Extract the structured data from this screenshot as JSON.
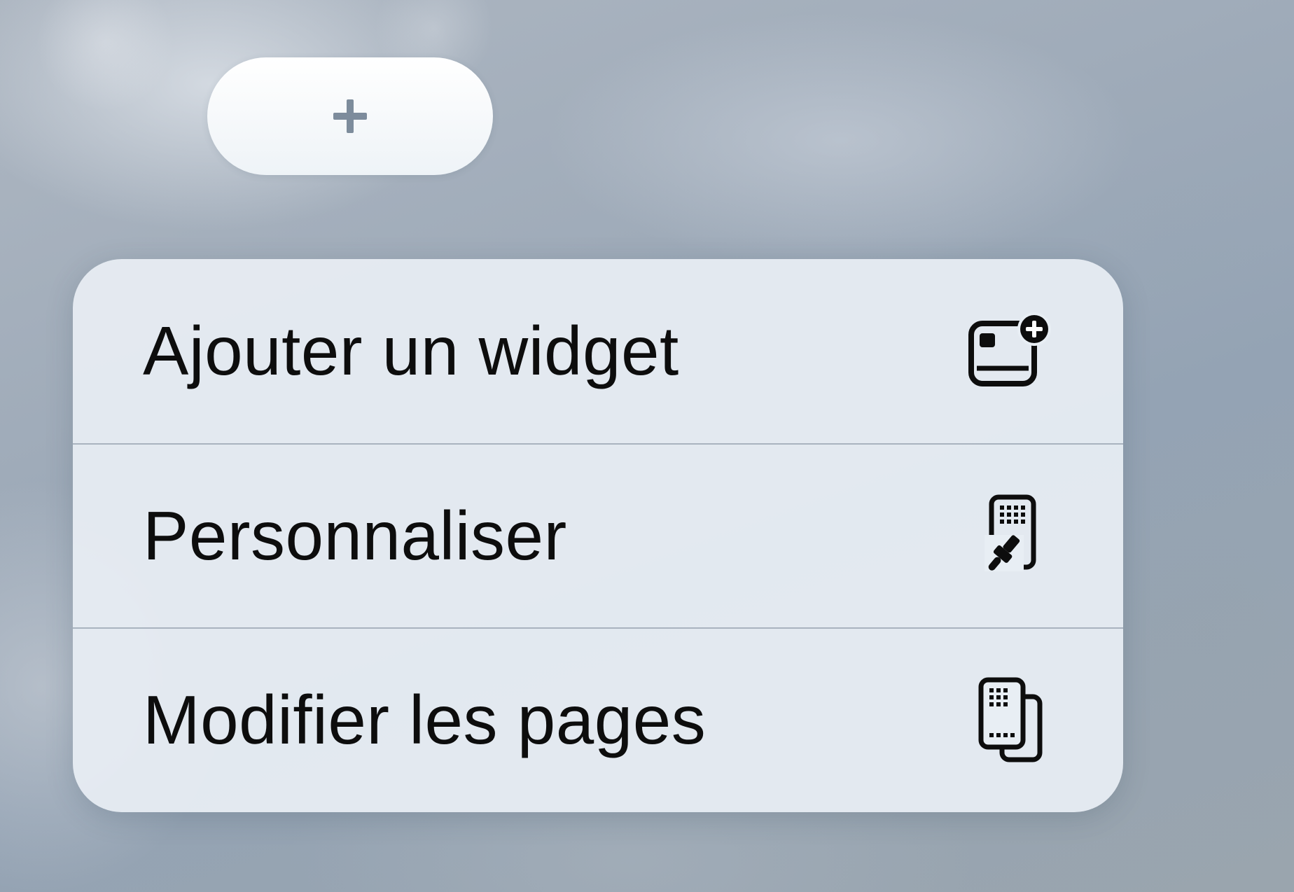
{
  "add_button": {
    "icon": "plus-icon"
  },
  "context_menu": {
    "items": [
      {
        "label": "Ajouter un widget",
        "icon": "widget-add-icon"
      },
      {
        "label": "Personnaliser",
        "icon": "customize-brush-icon"
      },
      {
        "label": "Modifier les pages",
        "icon": "edit-pages-icon"
      }
    ]
  },
  "colors": {
    "text": "#0d0d0d",
    "plus": "#7d8c9c",
    "menu_bg": "#e8eef4",
    "separator": "#a9b3bf"
  }
}
